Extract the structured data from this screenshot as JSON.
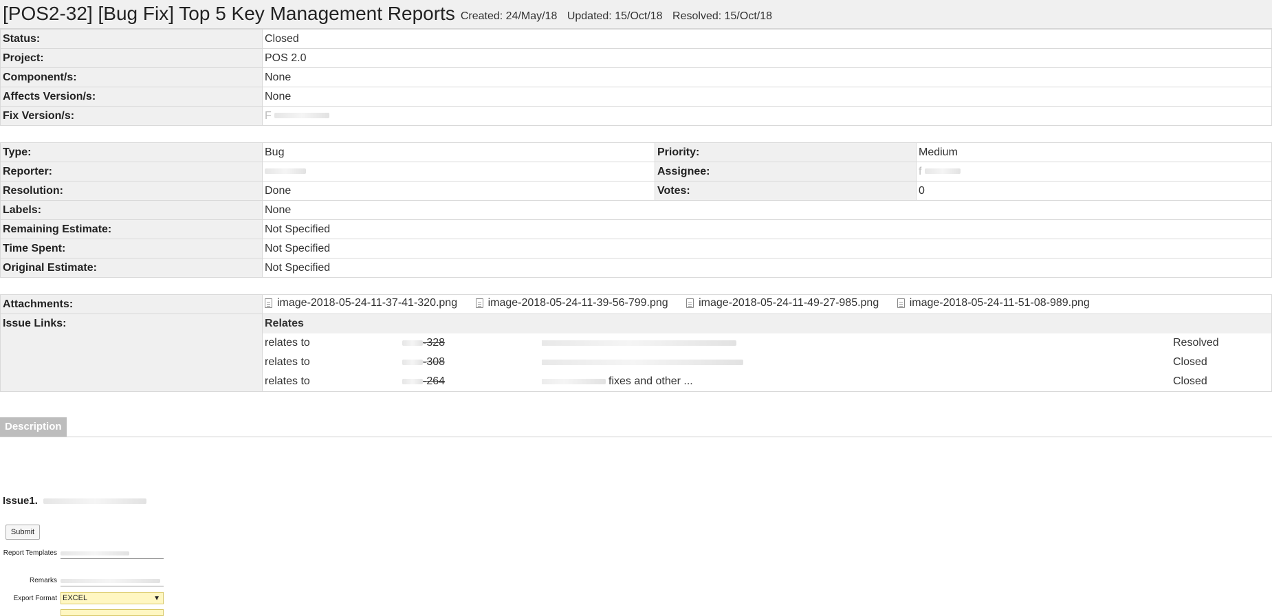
{
  "header": {
    "title": "[POS2-32] [Bug Fix] Top 5 Key Management Reports",
    "created": "Created: 24/May/18",
    "updated": "Updated: 15/Oct/18",
    "resolved": "Resolved: 15/Oct/18"
  },
  "fields1": [
    {
      "label": "Status:",
      "value": "Closed"
    },
    {
      "label": "Project:",
      "value": "POS 2.0"
    },
    {
      "label": "Component/s:",
      "value": "None"
    },
    {
      "label": "Affects Version/s:",
      "value": "None"
    },
    {
      "label": "Fix Version/s:",
      "value": "F"
    }
  ],
  "fields2": {
    "type_label": "Type:",
    "type_value": "Bug",
    "priority_label": "Priority:",
    "priority_value": "Medium",
    "reporter_label": "Reporter:",
    "reporter_value": "",
    "assignee_label": "Assignee:",
    "assignee_value": "f",
    "resolution_label": "Resolution:",
    "resolution_value": "Done",
    "votes_label": "Votes:",
    "votes_value": "0",
    "labels_label": "Labels:",
    "labels_value": "None",
    "remaining_label": "Remaining Estimate:",
    "remaining_value": "Not Specified",
    "spent_label": "Time Spent:",
    "spent_value": "Not Specified",
    "original_label": "Original Estimate:",
    "original_value": "Not Specified"
  },
  "attachments": {
    "label": "Attachments:",
    "files": [
      "image-2018-05-24-11-37-41-320.png",
      "image-2018-05-24-11-39-56-799.png",
      "image-2018-05-24-11-49-27-985.png",
      "image-2018-05-24-11-51-08-989.png"
    ]
  },
  "issue_links": {
    "label": "Issue Links:",
    "group": "Relates",
    "rows": [
      {
        "relation": "relates to",
        "key_suffix": "-328",
        "summary": "",
        "status": "Resolved"
      },
      {
        "relation": "relates to",
        "key_suffix": "-308",
        "summary": "",
        "status": "Closed"
      },
      {
        "relation": "relates to",
        "key_suffix": "-264",
        "summary": "fixes and other ...",
        "status": "Closed"
      }
    ]
  },
  "description": {
    "tab": "Description",
    "issue_heading": "Issue1.",
    "submit_label": "Submit",
    "report_templates_label": "Report Templates",
    "remarks_label": "Remarks",
    "export_format_label": "Export Format",
    "export_format_value": "EXCEL"
  }
}
